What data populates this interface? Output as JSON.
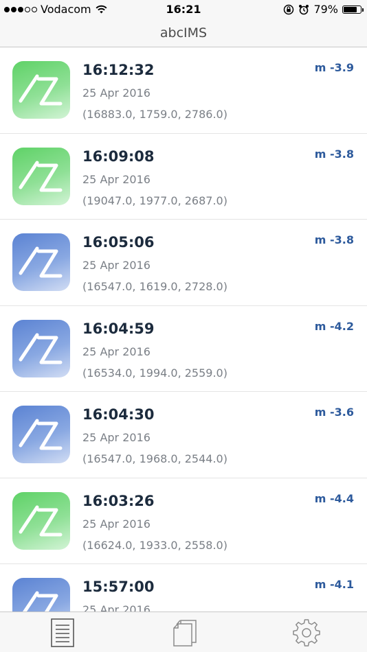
{
  "status_bar": {
    "carrier": "Vodacom",
    "time": "16:21",
    "battery_percent": "79%",
    "battery_level": 0.79,
    "signal_bars_filled": 3,
    "signal_bars_total": 5
  },
  "nav": {
    "title": "abcIMS"
  },
  "colors": {
    "accent": "#2d5a9c",
    "icon_green": "#5fd267",
    "icon_blue": "#5b83d3"
  },
  "events": [
    {
      "time": "16:12:32",
      "date": "25 Apr 2016",
      "coords": "(16883.0, 1759.0, 2786.0)",
      "magnitude": "m -3.9",
      "icon_color": "green"
    },
    {
      "time": "16:09:08",
      "date": "25 Apr 2016",
      "coords": "(19047.0, 1977.0, 2687.0)",
      "magnitude": "m -3.8",
      "icon_color": "green"
    },
    {
      "time": "16:05:06",
      "date": "25 Apr 2016",
      "coords": "(16547.0, 1619.0, 2728.0)",
      "magnitude": "m -3.8",
      "icon_color": "blue"
    },
    {
      "time": "16:04:59",
      "date": "25 Apr 2016",
      "coords": "(16534.0, 1994.0, 2559.0)",
      "magnitude": "m -4.2",
      "icon_color": "blue"
    },
    {
      "time": "16:04:30",
      "date": "25 Apr 2016",
      "coords": "(16547.0, 1968.0, 2544.0)",
      "magnitude": "m -3.6",
      "icon_color": "blue"
    },
    {
      "time": "16:03:26",
      "date": "25 Apr 2016",
      "coords": "(16624.0, 1933.0, 2558.0)",
      "magnitude": "m -4.4",
      "icon_color": "green"
    },
    {
      "time": "15:57:00",
      "date": "25 Apr 2016",
      "coords": "",
      "magnitude": "m -4.1",
      "icon_color": "blue"
    }
  ],
  "tab_bar": {
    "tabs": [
      {
        "icon": "document-list-icon"
      },
      {
        "icon": "documents-stack-icon"
      },
      {
        "icon": "gear-icon"
      }
    ]
  }
}
